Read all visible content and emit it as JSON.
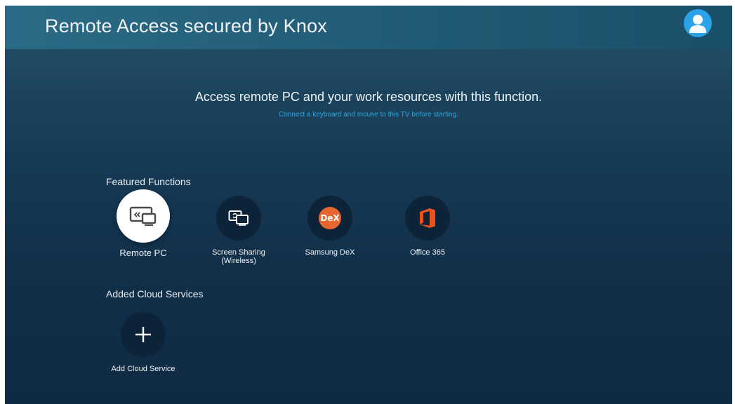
{
  "header": {
    "title": "Remote Access secured by Knox",
    "avatar_icon": "user-avatar-icon"
  },
  "hero": {
    "main_text": "Access remote PC and your work resources with this function.",
    "sub_text": "Connect a keyboard and mouse to this TV before starting."
  },
  "featured": {
    "title": "Featured Functions",
    "items": [
      {
        "label": "Remote PC",
        "icon": "remote-pc-icon",
        "focused": true
      },
      {
        "label": "Screen Sharing\n(Wireless)",
        "icon": "screen-sharing-icon",
        "focused": false
      },
      {
        "label": "Samsung DeX",
        "icon": "samsung-dex-icon",
        "badge_text": "DeX",
        "focused": false
      },
      {
        "label": "Office 365",
        "icon": "office-365-icon",
        "focused": false
      }
    ]
  },
  "cloud": {
    "title": "Added Cloud Services",
    "items": [
      {
        "label": "Add Cloud Service",
        "icon": "plus-icon"
      }
    ]
  },
  "colors": {
    "accent_blue": "#2fa4dc",
    "avatar_blue": "#2aa3e8",
    "office_orange": "#e8521f",
    "dex_orange": "#e8662f",
    "background_dark": "#0f2a44"
  }
}
